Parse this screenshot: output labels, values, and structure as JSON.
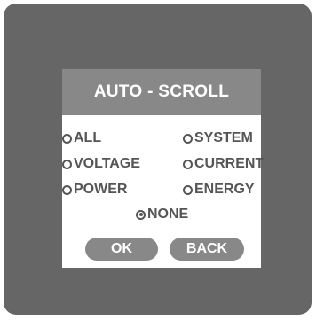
{
  "dialog": {
    "title": "AUTO - SCROLL",
    "options": [
      {
        "label": "ALL",
        "selected": false
      },
      {
        "label": "SYSTEM",
        "selected": false
      },
      {
        "label": "VOLTAGE",
        "selected": false
      },
      {
        "label": "CURRENT",
        "selected": false
      },
      {
        "label": "POWER",
        "selected": false
      },
      {
        "label": "ENERGY",
        "selected": false
      },
      {
        "label": "NONE",
        "selected": true
      }
    ],
    "ok_label": "OK",
    "back_label": "BACK"
  },
  "colors": {
    "screen_background": "#666666",
    "dialog_background": "#ffffff",
    "title_bar": "#888888",
    "option_text": "#555555",
    "button": "#888888"
  }
}
